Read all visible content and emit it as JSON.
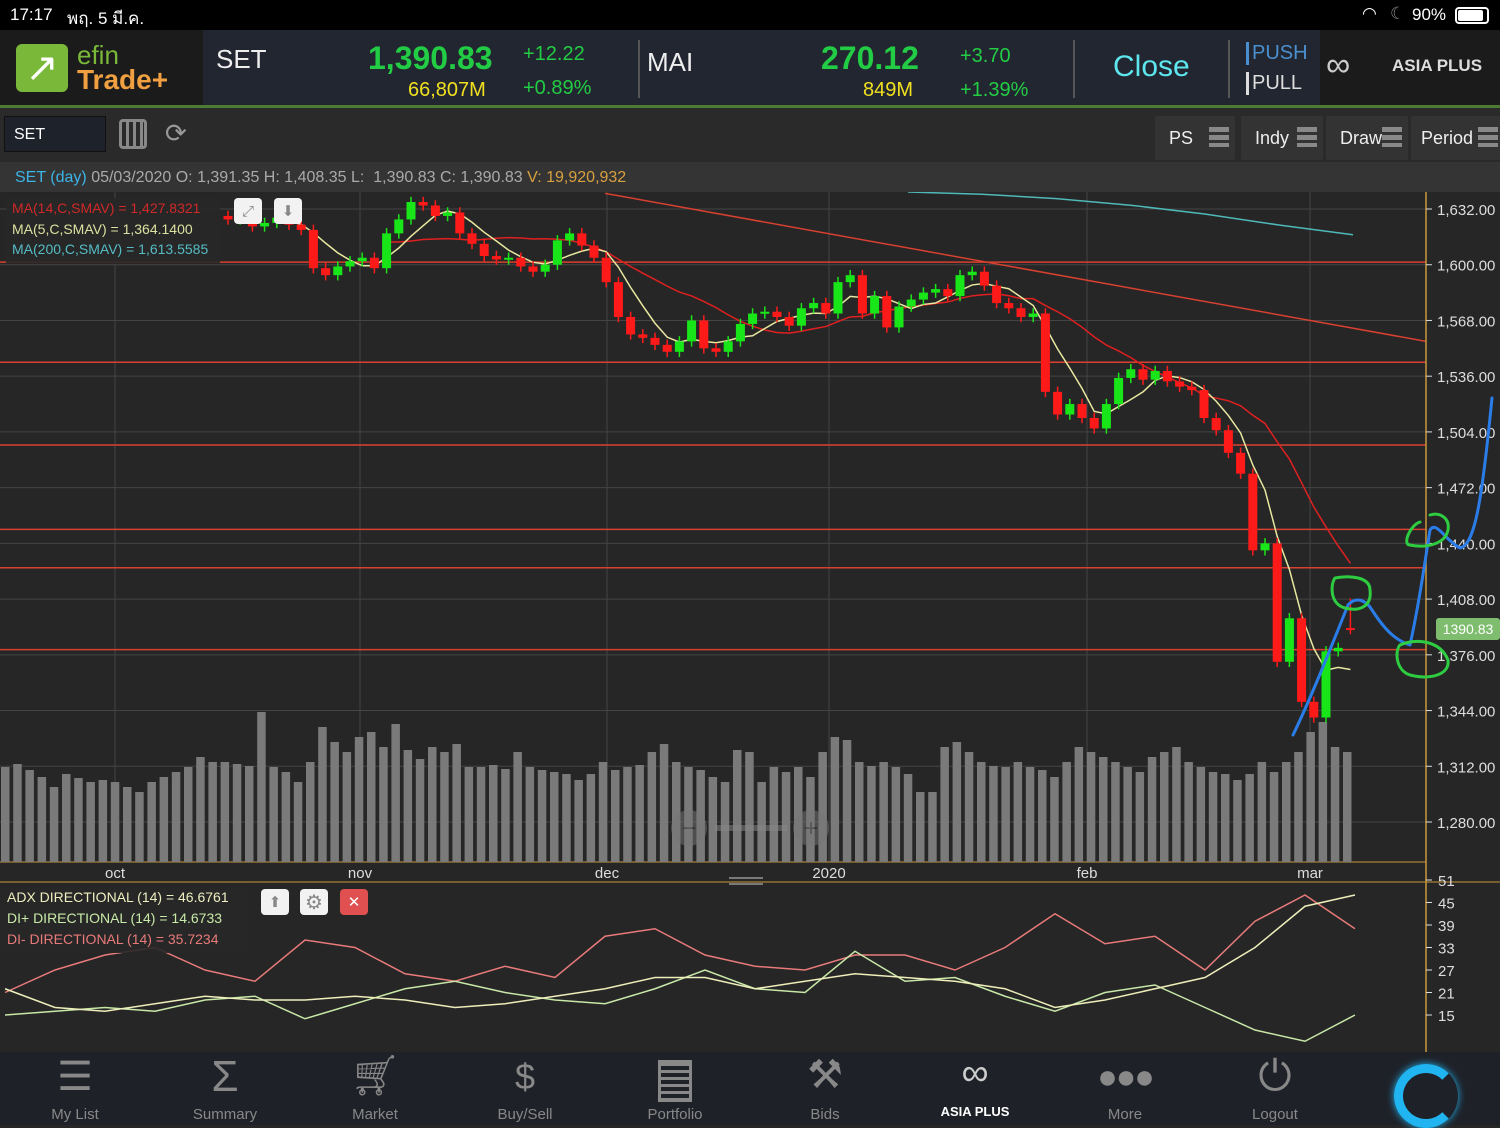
{
  "status_bar": {
    "time": "17:17",
    "date": "พฤ. 5 มี.ค.",
    "battery": "90%"
  },
  "header": {
    "logo_top": "efin",
    "logo_bottom": "Trade+",
    "set": {
      "name": "SET",
      "value": "1,390.83",
      "change": "+12.22",
      "volume": "66,807M",
      "pct": "+0.89%"
    },
    "mai": {
      "name": "MAI",
      "value": "270.12",
      "change": "+3.70",
      "volume": "849M",
      "pct": "+1.39%"
    },
    "market_status": "Close",
    "push": "PUSH",
    "pull": "PULL",
    "broker": "ASIA PLUS"
  },
  "toolbar": {
    "symbol": "SET",
    "buttons": [
      "PS",
      "Indy",
      "Draw",
      "Period"
    ]
  },
  "info": {
    "symbol": "SET (day)",
    "date": "05/03/2020",
    "o_label": "O:",
    "open": "1,391.35",
    "h_label": "H:",
    "high": "1,408.35",
    "l_label": "L:",
    "low": "1,390.83",
    "c_label": "C:",
    "close": "1,390.83",
    "v_label": "V:",
    "volume": "19,920,932"
  },
  "ma_legend": [
    "MA(14,C,SMAV) = 1,427.8321",
    "MA(5,C,SMAV) = 1,364.1400",
    "MA(200,C,SMAV) = 1,613.5585"
  ],
  "adx_legend": [
    "ADX DIRECTIONAL (14) = 46.6761",
    "DI+ DIRECTIONAL (14) = 14.6733",
    "DI- DIRECTIONAL (14) = 35.7234"
  ],
  "colors": {
    "up": "#19e619",
    "down": "#ff1a1a",
    "ma14": "#e02020",
    "ma5": "#e8e8a0",
    "ma200": "#4fb8b8",
    "adx": "#eeeebb",
    "diplus": "#c8e8a8",
    "diminus": "#e87a7a",
    "axis": "#c8983c",
    "last_price": "#7ebd6e"
  },
  "chart_data": {
    "type": "candlestick",
    "price_ticks": [
      "1,632.00",
      "1,600.00",
      "1,568.00",
      "1,536.00",
      "1,504.00",
      "1,472.00",
      "1,440.00",
      "1,408.00",
      "1,376.00",
      "1,344.00",
      "1,312.00",
      "1,280.00"
    ],
    "price_tick_values": [
      1632,
      1600,
      1568,
      1536,
      1504,
      1472,
      1440,
      1408,
      1376,
      1344,
      1312,
      1280
    ],
    "last_price_label": "1390.83",
    "last_price": 1390.83,
    "months": [
      "oct",
      "nov",
      "dec",
      "2020",
      "feb",
      "mar"
    ],
    "closes": [
      1626,
      1628,
      1622,
      1624,
      1627,
      1623,
      1620,
      1598,
      1594,
      1599,
      1602,
      1604,
      1598,
      1618,
      1626,
      1636,
      1634,
      1628,
      1630,
      1618,
      1612,
      1605,
      1603,
      1604,
      1599,
      1596,
      1600,
      1614,
      1618,
      1611,
      1604,
      1590,
      1570,
      1560,
      1558,
      1554,
      1550,
      1556,
      1568,
      1552,
      1550,
      1556,
      1566,
      1572,
      1573,
      1570,
      1565,
      1575,
      1578,
      1572,
      1590,
      1594,
      1572,
      1582,
      1564,
      1576,
      1580,
      1584,
      1586,
      1582,
      1594,
      1596,
      1588,
      1578,
      1575,
      1570,
      1572,
      1527,
      1514,
      1520,
      1512,
      1506,
      1520,
      1535,
      1540,
      1534,
      1539,
      1533,
      1530,
      1528,
      1512,
      1505,
      1492,
      1480,
      1436,
      1440,
      1372,
      1397,
      1349,
      1340,
      1378,
      1380,
      1390.83
    ],
    "last_open": 1391.35,
    "last_high": 1408.35,
    "ma200": [
      1633,
      1632,
      1630,
      1627,
      1623,
      1618,
      1613.56
    ],
    "horizontal_lines": [
      1601.5,
      1544,
      1496.5,
      1448,
      1426,
      1379
    ],
    "trendline": [
      1641,
      1556
    ],
    "volume": [
      95,
      98,
      92,
      85,
      75,
      88,
      84,
      80,
      82,
      80,
      75,
      70,
      80,
      85,
      90,
      95,
      105,
      100,
      100,
      98,
      96,
      150,
      95,
      90,
      80,
      100,
      135,
      120,
      110,
      125,
      130,
      115,
      138,
      112,
      103,
      115,
      110,
      118,
      95,
      95,
      97,
      93,
      110,
      95,
      92,
      90,
      88,
      82,
      88,
      100,
      92,
      95,
      97,
      110,
      118,
      100,
      95,
      92,
      85,
      80,
      112,
      110,
      80,
      95,
      90,
      95,
      85,
      110,
      125,
      122,
      100,
      96,
      100,
      95,
      88,
      70,
      70,
      115,
      120,
      110,
      100,
      96,
      95,
      100,
      95,
      92,
      85,
      100,
      115,
      110,
      105,
      100,
      95,
      90,
      105,
      110,
      115,
      100,
      95,
      90,
      88,
      82,
      88,
      100,
      90,
      100,
      110,
      130,
      140,
      115,
      110,
      95,
      90,
      100
    ],
    "adx_ticks": [
      51,
      45,
      39,
      33,
      27,
      21,
      15
    ],
    "adx": [
      22,
      17,
      16,
      18,
      20,
      19,
      19,
      20,
      19,
      17,
      18,
      20,
      22,
      25,
      25,
      22,
      24,
      26,
      25,
      24,
      22,
      17,
      19,
      22,
      25,
      33,
      44,
      47
    ],
    "di_plus": [
      15,
      16,
      17,
      16,
      19,
      20,
      14,
      18,
      22,
      24,
      21,
      19,
      18,
      22,
      27,
      22,
      21,
      32,
      24,
      25,
      20,
      16,
      21,
      23,
      17,
      11,
      8,
      15
    ],
    "di_minus": [
      21,
      27,
      31,
      33,
      27,
      24,
      35,
      33,
      26,
      24,
      28,
      25,
      36,
      38,
      31,
      28,
      27,
      31,
      31,
      27,
      33,
      42,
      34,
      36,
      27,
      40,
      47,
      38
    ]
  },
  "nav": [
    "My List",
    "Summary",
    "Market",
    "Buy/Sell",
    "Portfolio",
    "Bids",
    "ASIA PLUS",
    "More",
    "Logout"
  ]
}
